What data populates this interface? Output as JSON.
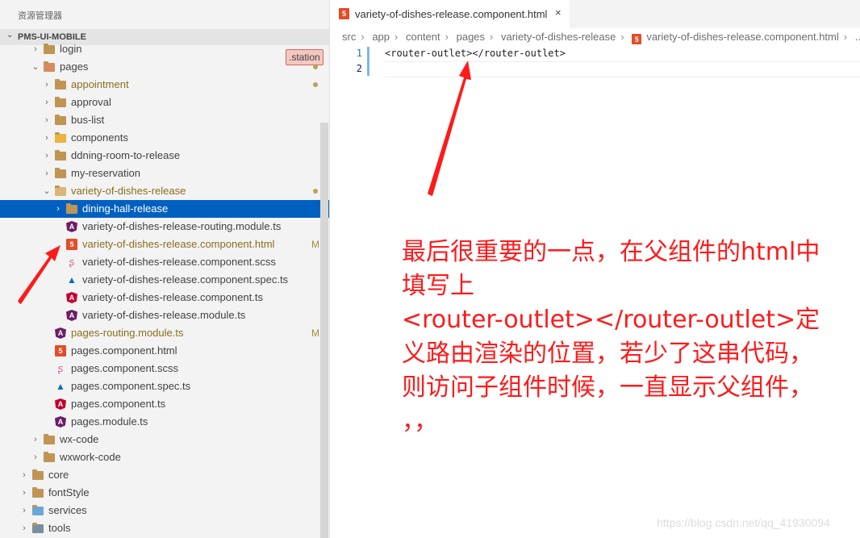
{
  "explorer": {
    "title": "资源管理器",
    "root": "PMS-UI-MOBILE",
    "tag": ".station"
  },
  "tree": [
    {
      "name": "login",
      "icon": "folder-icon",
      "chevron": "›",
      "color": "#424242"
    },
    {
      "name": "pages",
      "icon": "folder-open-icon",
      "chevron": "⌄",
      "color": "#424242",
      "dot": true
    },
    {
      "name": "appointment",
      "icon": "folder-icon",
      "chevron": "›",
      "color": "#8a6d1f",
      "dot": true
    },
    {
      "name": "approval",
      "icon": "folder-icon",
      "chevron": "›",
      "color": "#424242"
    },
    {
      "name": "bus-list",
      "icon": "folder-icon",
      "chevron": "›",
      "color": "#424242"
    },
    {
      "name": "components",
      "icon": "folder-components-icon",
      "chevron": "›",
      "color": "#424242"
    },
    {
      "name": "ddning-room-to-release",
      "icon": "folder-icon",
      "chevron": "›",
      "color": "#424242"
    },
    {
      "name": "my-reservation",
      "icon": "folder-icon",
      "chevron": "›",
      "color": "#424242"
    },
    {
      "name": "variety-of-dishes-release",
      "icon": "folder-open-icon",
      "chevron": "⌄",
      "color": "#8a6d1f",
      "dot": true
    },
    {
      "name": "dining-hall-release",
      "icon": "folder-icon",
      "chevron": "›",
      "color": "#ffffff",
      "selected": true
    },
    {
      "name": "variety-of-dishes-release-routing.module.ts",
      "icon": "angular-icon",
      "color": "#424242"
    },
    {
      "name": "variety-of-dishes-release.component.html",
      "icon": "html5-icon",
      "color": "#8a6d1f",
      "mod": "M"
    },
    {
      "name": "variety-of-dishes-release.component.scss",
      "icon": "sass-icon",
      "color": "#424242"
    },
    {
      "name": "variety-of-dishes-release.component.spec.ts",
      "icon": "spec-icon",
      "color": "#424242"
    },
    {
      "name": "variety-of-dishes-release.component.ts",
      "icon": "angular-red-icon",
      "color": "#424242"
    },
    {
      "name": "variety-of-dishes-release.module.ts",
      "icon": "angular-icon",
      "color": "#424242"
    },
    {
      "name": "pages-routing.module.ts",
      "icon": "angular-icon",
      "color": "#8a6d1f",
      "mod": "M"
    },
    {
      "name": "pages.component.html",
      "icon": "html5-icon",
      "color": "#424242"
    },
    {
      "name": "pages.component.scss",
      "icon": "sass-icon",
      "color": "#424242"
    },
    {
      "name": "pages.component.spec.ts",
      "icon": "spec-icon",
      "color": "#424242"
    },
    {
      "name": "pages.component.ts",
      "icon": "angular-red-icon",
      "color": "#424242"
    },
    {
      "name": "pages.module.ts",
      "icon": "angular-icon",
      "color": "#424242"
    },
    {
      "name": "wx-code",
      "icon": "folder-icon",
      "chevron": "›",
      "color": "#424242"
    },
    {
      "name": "wxwork-code",
      "icon": "folder-icon",
      "chevron": "›",
      "color": "#424242"
    },
    {
      "name": "core",
      "icon": "folder-icon",
      "chevron": "›",
      "color": "#424242"
    },
    {
      "name": "fontStyle",
      "icon": "folder-icon",
      "chevron": "›",
      "color": "#424242"
    },
    {
      "name": "services",
      "icon": "folder-services-icon",
      "chevron": "›",
      "color": "#424242"
    },
    {
      "name": "tools",
      "icon": "folder-tools-icon",
      "chevron": "›",
      "color": "#424242"
    }
  ],
  "editor": {
    "tab_title": "variety-of-dishes-release.component.html",
    "close": "×",
    "breadcrumb": [
      "src",
      "app",
      "content",
      "pages",
      "variety-of-dishes-release",
      "variety-of-dishes-release.component.html",
      "..."
    ],
    "lines": [
      {
        "number": "1",
        "text": "<router-outlet></router-outlet>"
      },
      {
        "number": "2",
        "text": ""
      }
    ]
  },
  "annotation": {
    "lines": [
      "最后很重要的一点，在父组件的html中",
      "填写上",
      "<router-outlet></router-outlet>定",
      "义路由渲染的位置，若少了这串代码，",
      "则访问子组件时候，一直显示父组件，",
      "，，"
    ],
    "color": "#ff1a1a"
  },
  "watermark": "https://blog.csdn.net/qq_41930094"
}
